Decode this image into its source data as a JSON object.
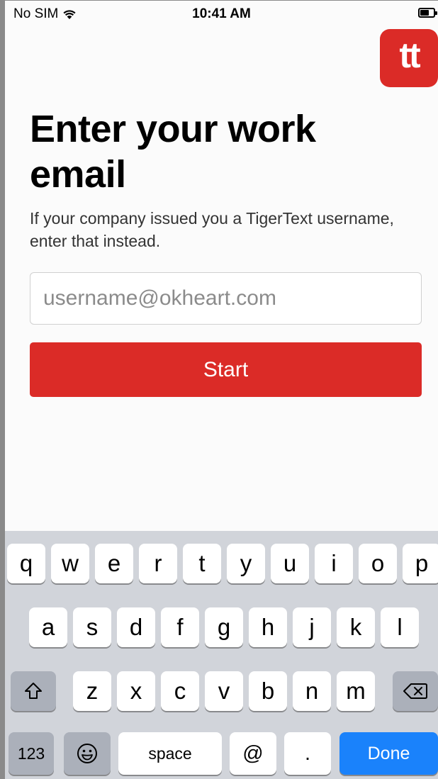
{
  "status_bar": {
    "carrier": "No SIM",
    "time": "10:41 AM"
  },
  "logo": {
    "text": "tt"
  },
  "title": "Enter your work email",
  "subtitle": "If your company issued you a TigerText username, enter that instead.",
  "email_input": {
    "placeholder": "username@okheart.com",
    "value": ""
  },
  "start_button": {
    "label": "Start"
  },
  "keyboard": {
    "row1": [
      "q",
      "w",
      "e",
      "r",
      "t",
      "y",
      "u",
      "i",
      "o",
      "p"
    ],
    "row2": [
      "a",
      "s",
      "d",
      "f",
      "g",
      "h",
      "j",
      "k",
      "l"
    ],
    "row3": [
      "z",
      "x",
      "c",
      "v",
      "b",
      "n",
      "m"
    ],
    "numbers_label": "123",
    "space_label": "space",
    "at_label": "@",
    "dot_label": ".",
    "done_label": "Done"
  },
  "colors": {
    "brand": "#db2b27",
    "done_key": "#1a82fb",
    "keyboard_bg": "#d1d4da"
  }
}
